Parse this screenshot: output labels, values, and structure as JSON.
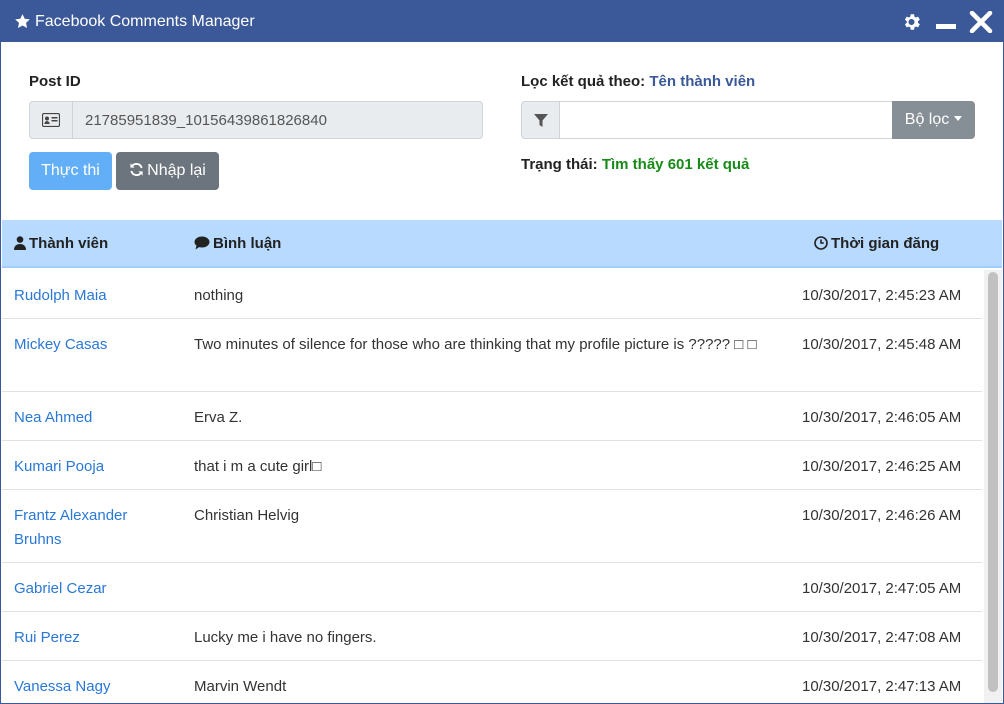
{
  "window": {
    "title": "Facebook Comments Manager"
  },
  "form": {
    "post_id_label": "Post ID",
    "post_id_value": "21785951839_10156439861826840",
    "run_label": "Thực thi",
    "reset_label": "Nhập lại",
    "filter_label_prefix": "Lọc kết quả theo:",
    "filter_by": "Tên thành viên",
    "filter_value": "",
    "filter_button_label": "Bộ lọc",
    "status_prefix": "Trạng thái:",
    "status_value": "Tìm thấy 601 kết quả"
  },
  "table": {
    "headers": {
      "member": "Thành viên",
      "comment": "Bình luận",
      "time": "Thời gian đăng"
    },
    "rows": [
      {
        "member": "Rudolph Maia",
        "comment": "nothing",
        "time": "10/30/2017, 2:45:23 AM"
      },
      {
        "member": "Mickey Casas",
        "comment": "Two minutes of silence for those who are thinking that my profile picture is ????? □ □",
        "time": "10/30/2017, 2:45:48 AM"
      },
      {
        "member": "Nea Ahmed",
        "comment": "Erva Z.",
        "time": "10/30/2017, 2:46:05 AM"
      },
      {
        "member": "Kumari Pooja",
        "comment": "that i m a cute girl□",
        "time": "10/30/2017, 2:46:25 AM"
      },
      {
        "member": "Frantz Alexander Bruhns",
        "comment": "Christian Helvig",
        "time": "10/30/2017, 2:46:26 AM"
      },
      {
        "member": "Gabriel Cezar",
        "comment": "",
        "time": "10/30/2017, 2:47:05 AM"
      },
      {
        "member": "Rui Perez",
        "comment": "Lucky me i have no fingers.",
        "time": "10/30/2017, 2:47:08 AM"
      },
      {
        "member": "Vanessa Nagy",
        "comment": "Marvin Wendt",
        "time": "10/30/2017, 2:47:13 AM"
      }
    ]
  },
  "colors": {
    "titlebar": "#3b5998",
    "header_row": "#b8daff",
    "link": "#2a78d6",
    "status_ok": "#178a17"
  }
}
